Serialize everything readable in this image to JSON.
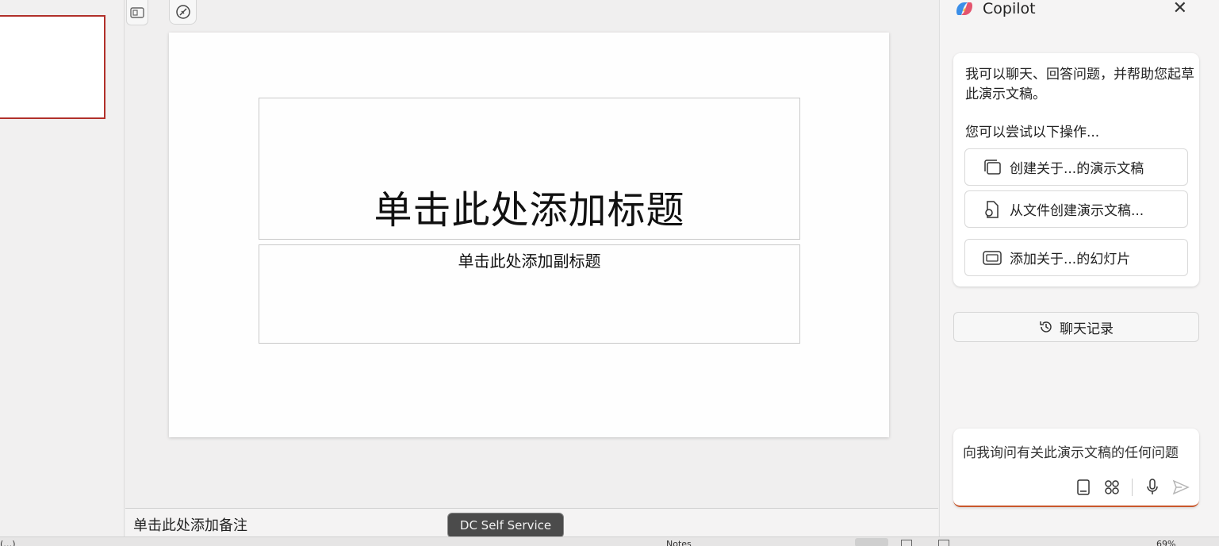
{
  "slide": {
    "title_placeholder": "单击此处添加标题",
    "subtitle_placeholder": "单击此处添加副标题"
  },
  "notes": {
    "placeholder": "单击此处添加备注"
  },
  "tooltip": {
    "text": "DC Self Service"
  },
  "copilot": {
    "title": "Copilot",
    "intro": "我可以聊天、回答问题，并帮助您起草此演示文稿。",
    "try_label": "您可以尝试以下操作...",
    "suggestions": [
      {
        "label": "创建关于...的演示文稿",
        "icon": "presentation-icon"
      },
      {
        "label": "从文件创建演示文稿...",
        "icon": "file-icon"
      },
      {
        "label": "添加关于...的幻灯片",
        "icon": "slide-icon"
      }
    ],
    "history_label": "聊天记录",
    "input_placeholder": "向我询问有关此演示文稿的任何问题",
    "accent": "#c9572c"
  },
  "status": {
    "slide_info": "(…)",
    "notes_label": "Notes",
    "zoom": "69%"
  }
}
